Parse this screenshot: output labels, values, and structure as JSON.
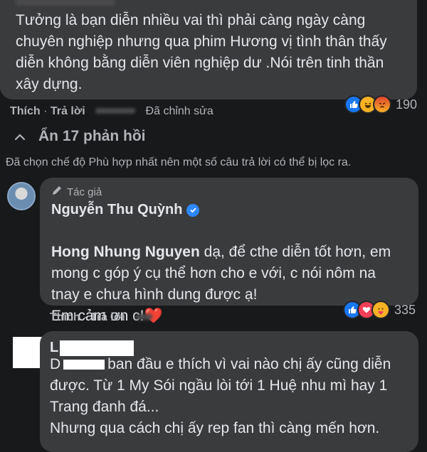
{
  "comment1": {
    "text": "Tưởng là bạn diễn nhiều vai thì phải càng ngày càng\nchuyên nghiệp nhưng qua phim Hương vị tình thân thấy\ndiễn không bằng diễn viên nghiệp dư .Nói trên tinh thần\nxây dựng.",
    "like_label": "Thích",
    "reply_label": "Trả lời",
    "edited_label": "Đã chỉnh sửa",
    "reaction_count": "190",
    "reaction_icons": [
      "like-reaction",
      "haha-reaction",
      "angry-reaction"
    ]
  },
  "hidden_replies": {
    "label": "Ẩn 17 phản hồi",
    "filter_note": "Đã chọn chế độ Phù hợp nhất nên một số câu trả lời có thể bị lọc ra."
  },
  "reply1": {
    "author_badge": "Tác giả",
    "author_name": "Nguyễn Thu Quỳnh",
    "mention": "Hong Nhung Nguyen",
    "text": " dạ, để cthe diễn tốt hơn, em\nmong c góp ý cụ thể hơn cho e với, c nói nôm na\ntnay e chưa hình dung được ạ!\nEm cảm ơn c!",
    "emoji": "❤️",
    "like_label": "Thích",
    "reply_label": "Trả lời",
    "reaction_count": "335",
    "reaction_icons": [
      "like-reaction",
      "love-reaction",
      "care-reaction"
    ]
  },
  "reply2": {
    "author_initial": "L",
    "line1_prefix": "D",
    "line1_suffix": "ban đầu e thích vì vai nào chị ấy cũng diễn",
    "text": "được. Từ 1 My Sói ngầu lòi tới 1 Huệ nhu mì hay 1\nTrang đanh đá...\nNhưng qua cách chị ấy rep fan thì càng mến hơn."
  },
  "colors": {
    "background": "#18191a",
    "bubble": "#3a3b3c",
    "text": "#e4e6eb",
    "muted": "#b0b3b8",
    "like_blue": "#1877f2",
    "love_red": "#f33e58",
    "haha_yellow": "#f7b125",
    "verified_blue": "#2d88ff"
  }
}
